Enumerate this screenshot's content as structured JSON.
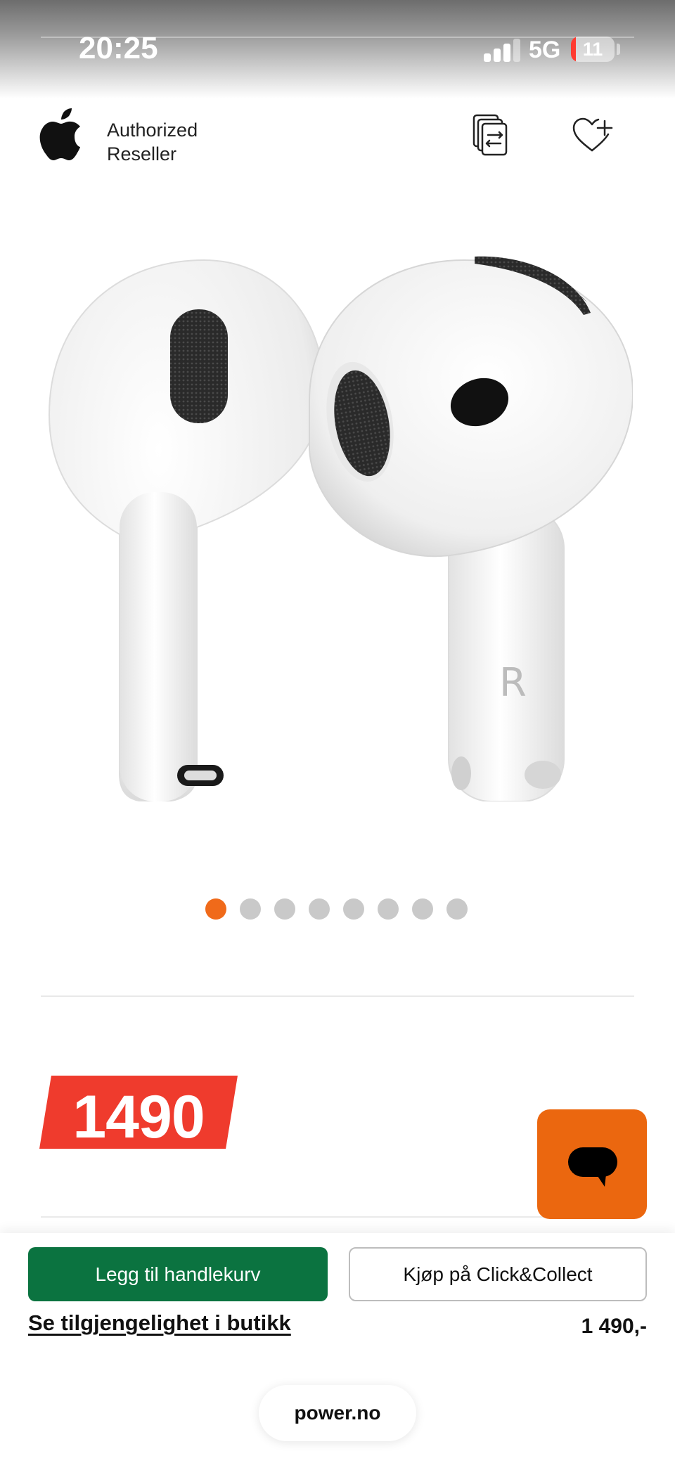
{
  "status_bar": {
    "time": "20:25",
    "network": "5G",
    "battery_level": "11",
    "battery_percent": 11,
    "signal_icon": "signal-bars-icon"
  },
  "header": {
    "logo_icon": "apple-logo-icon",
    "reseller_line1": "Authorized",
    "reseller_line2": "Reseller",
    "compare_icon": "compare-icon",
    "wishlist_icon": "heart-plus-icon"
  },
  "gallery": {
    "image_count": 8,
    "active_index": 0,
    "stem_letter": "R"
  },
  "price": {
    "badge_value": "1490"
  },
  "chat": {
    "icon": "chat-bubble-icon",
    "accent_color": "#eb670f"
  },
  "actions": {
    "add_to_cart_label": "Legg til handlekurv",
    "click_collect_label": "Kjøp på Click&Collect",
    "availability_link": "Se tilgjengelighet i butikk",
    "footer_price": "1 490,-"
  },
  "browser": {
    "url": "power.no"
  },
  "colors": {
    "price_badge": "#ef3b2d",
    "add_to_cart": "#0b7340",
    "dot_active": "#f06a1a",
    "dot_inactive": "#c9c9c9"
  }
}
